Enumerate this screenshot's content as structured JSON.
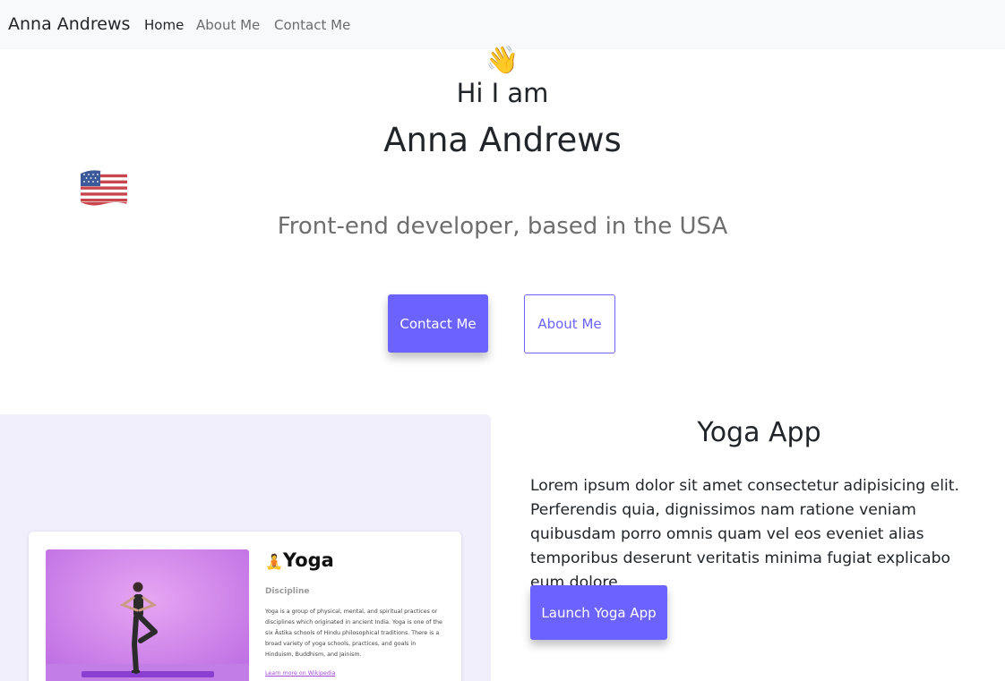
{
  "navbar": {
    "brand": "Anna Andrews",
    "links": [
      {
        "label": "Home",
        "active": true
      },
      {
        "label": "About Me",
        "active": false
      },
      {
        "label": "Contact Me",
        "active": false
      }
    ]
  },
  "hero": {
    "wave_emoji": "👋",
    "greeting": "Hi I am",
    "name": "Anna Andrews",
    "flag_icon": "us-flag-icon",
    "tagline": "Front-end developer, based in the USA",
    "contact_button": "Contact Me",
    "about_button": "About Me"
  },
  "project": {
    "title": "Yoga App",
    "description": "Lorem ipsum dolor sit amet consectetur adipisicing elit. Perferendis quia, dignissimos nam ratione veniam quibusdam porro omnis quam vel eos eveniet alias temporibus deserunt veritatis minima fugiat explicabo eum dolore.",
    "launch_button": "Launch Yoga App",
    "preview": {
      "emoji": "🧘",
      "title": "Yoga",
      "subtitle": "Discipline",
      "text": "Yoga is a group of physical, mental, and spiritual practices or disciplines which originated in ancient India. Yoga is one of the six Āstika schools of Hindu philosophical traditions. There is a broad variety of yoga schools, practices, and goals in Hinduism, Buddhism, and Jainism.",
      "link": "Learn more on Wikipedia"
    }
  },
  "colors": {
    "accent": "#6c63ff",
    "navbar_bg": "#f8f9fa",
    "preview_bg": "#f2effd"
  }
}
